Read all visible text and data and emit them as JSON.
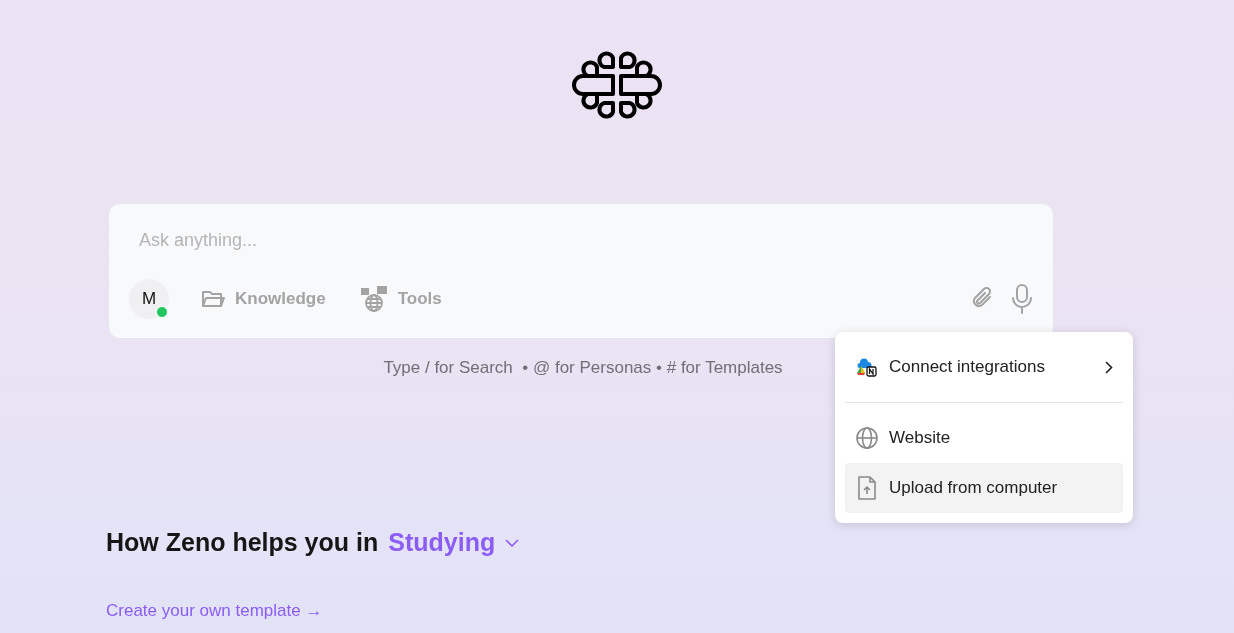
{
  "composer": {
    "placeholder": "Ask anything...",
    "avatar": {
      "initial": "M",
      "online": true
    },
    "actions": [
      {
        "kind": "knowledge",
        "label": "Knowledge"
      },
      {
        "kind": "tools",
        "label": "Tools"
      }
    ]
  },
  "hint": "Type / for Search  • @ for Personas • # for Templates",
  "menu": [
    {
      "kind": "integrations",
      "label": "Connect integrations",
      "highlighted": false
    },
    {
      "kind": "website",
      "label": "Website",
      "highlighted": false
    },
    {
      "kind": "upload",
      "label": "Upload from computer",
      "highlighted": true
    }
  ],
  "section": {
    "heading": "How Zeno helps you in",
    "category": "Studying",
    "link": "Create your own template →"
  }
}
